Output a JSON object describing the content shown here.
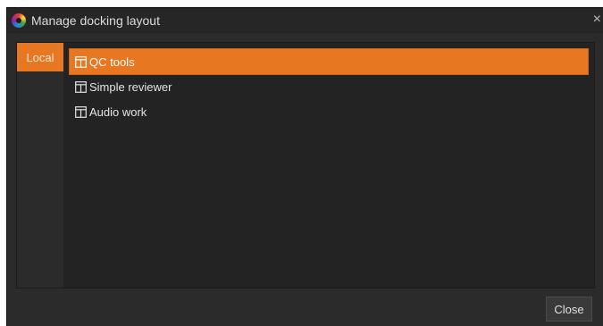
{
  "window": {
    "title": "Manage docking layout",
    "close_glyph": "×",
    "icon": "color-wheel-icon"
  },
  "tabs": {
    "local_label": "Local"
  },
  "toolbar": {
    "icons": [
      "new-file-icon",
      "save-icon",
      "edit-icon",
      "delete-icon",
      "undo-icon"
    ],
    "more_glyph": "⩡"
  },
  "layouts": [
    {
      "label": "QC tools",
      "selected": true,
      "icon": "layout-icon"
    },
    {
      "label": "Simple reviewer",
      "selected": false,
      "icon": "layout-icon"
    },
    {
      "label": "Audio work",
      "selected": false,
      "icon": "layout-icon"
    }
  ],
  "footer": {
    "close_label": "Close"
  },
  "colors": {
    "accent": "#e87722",
    "background": "#2b2b2b",
    "panel": "#232323"
  }
}
